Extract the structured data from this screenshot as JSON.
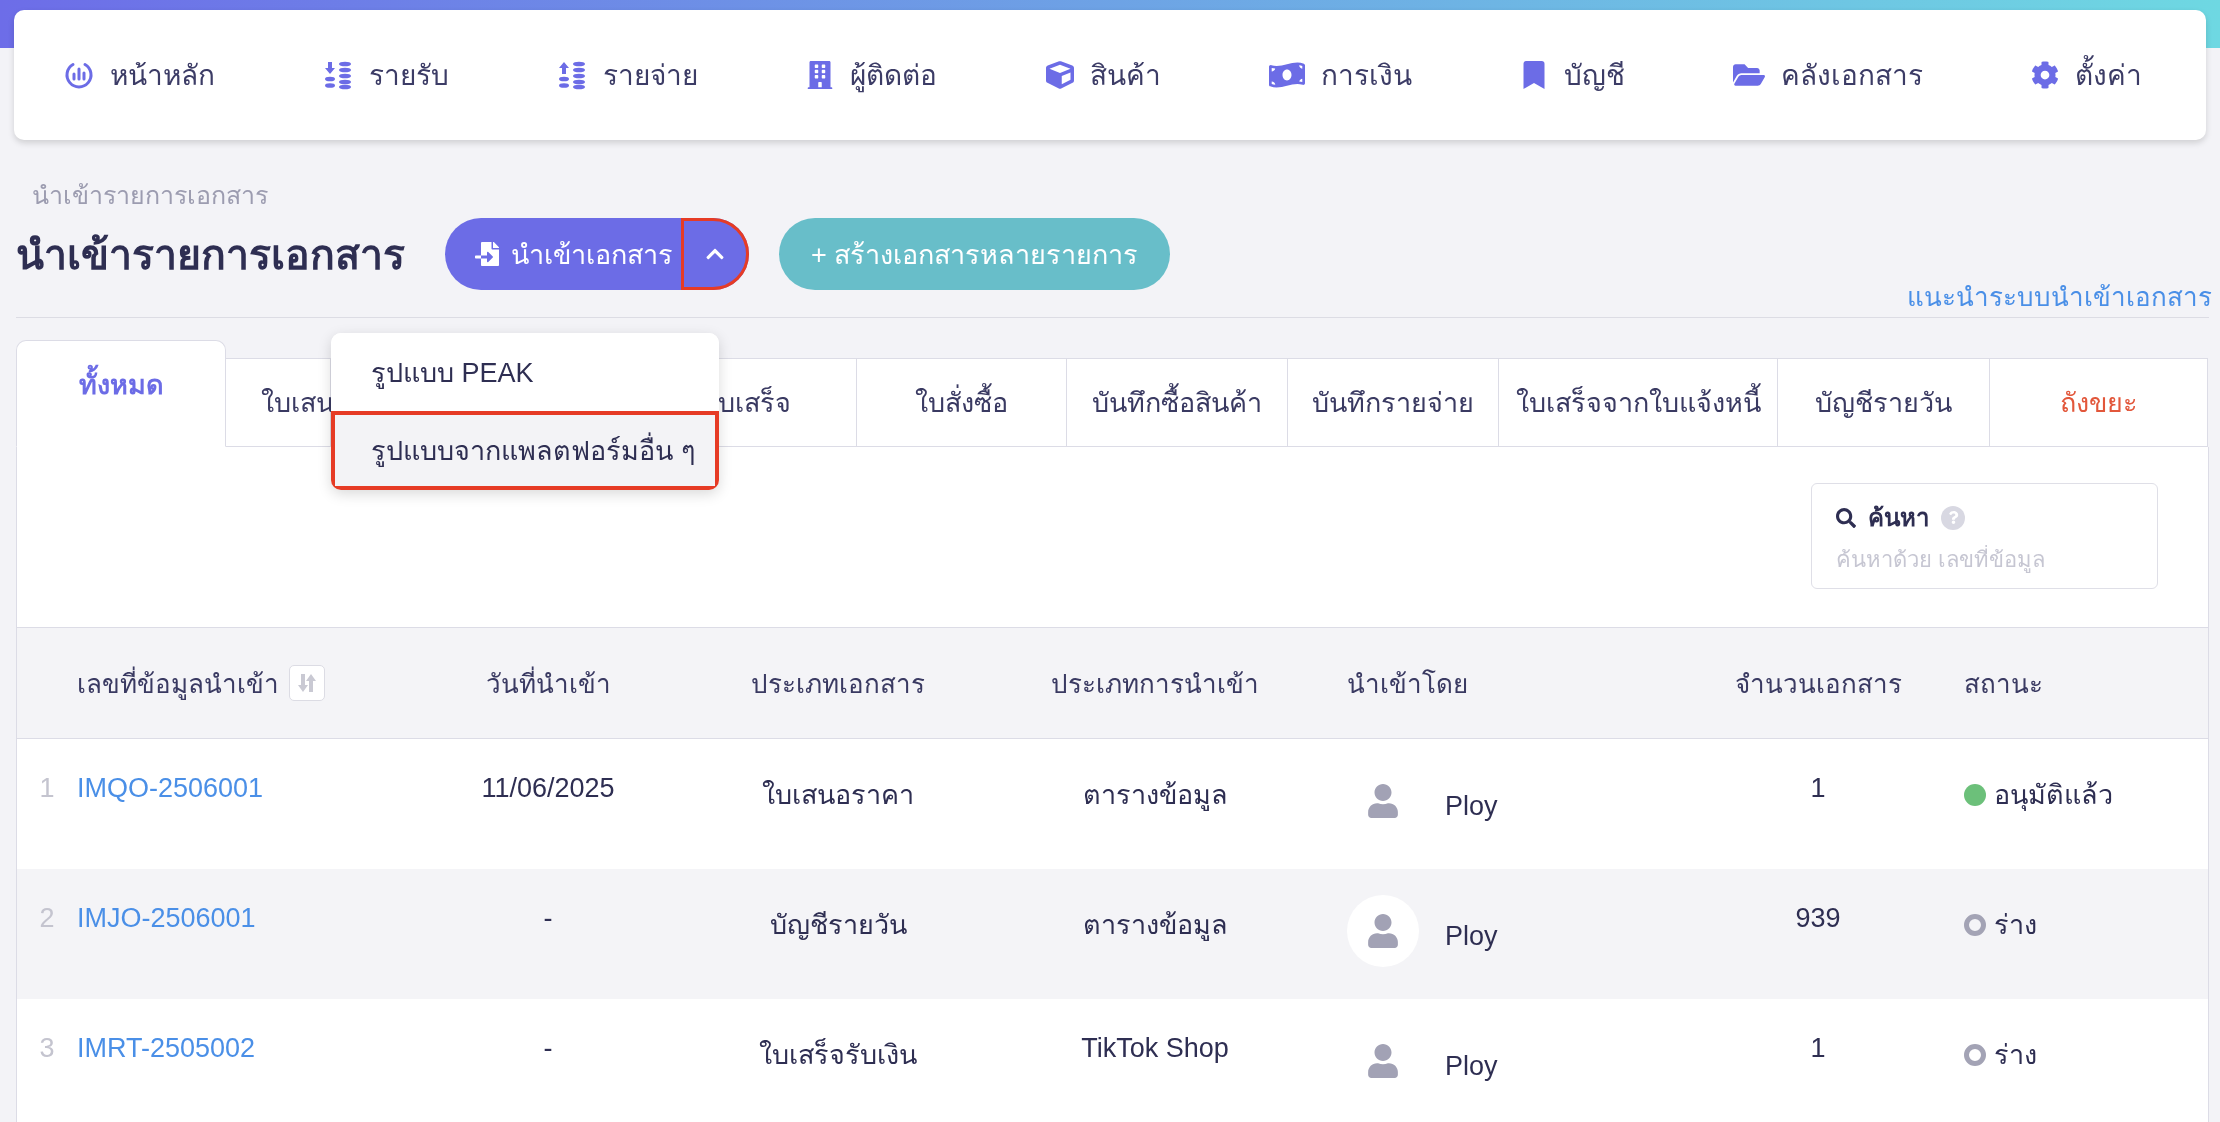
{
  "nav": [
    {
      "label": "หน้าหลัก"
    },
    {
      "label": "รายรับ"
    },
    {
      "label": "รายจ่าย"
    },
    {
      "label": "ผู้ติดต่อ"
    },
    {
      "label": "สินค้า"
    },
    {
      "label": "การเงิน"
    },
    {
      "label": "บัญชี"
    },
    {
      "label": "คลังเอกสาร"
    },
    {
      "label": "ตั้งค่า"
    }
  ],
  "breadcrumb": "นำเข้ารายการเอกสาร",
  "title": "นำเข้ารายการเอกสาร",
  "import_button": {
    "label": "นำเข้าเอกสาร",
    "expanded": true,
    "highlighted": true
  },
  "import_menu": [
    {
      "label": "รูปแบบ PEAK",
      "selected": false
    },
    {
      "label": "รูปแบบจากแพลตฟอร์มอื่น ๆ",
      "selected": true
    }
  ],
  "create_button": {
    "label": "+ สร้างเอกสารหลายรายการ"
  },
  "guide_link": "แนะนำระบบนำเข้าเอกสาร",
  "tabs": [
    {
      "label": "ทั้งหมด",
      "selected": true,
      "kind": "normal"
    },
    {
      "label": "ใบเสน",
      "selected": false,
      "kind": "normal"
    },
    {
      "label": "บเสร็จ",
      "selected": false,
      "kind": "normal"
    },
    {
      "label": "ใบสั่งซื้อ",
      "selected": false,
      "kind": "normal"
    },
    {
      "label": "บันทึกซื้อสินค้า",
      "selected": false,
      "kind": "normal"
    },
    {
      "label": "บันทึกรายจ่าย",
      "selected": false,
      "kind": "normal"
    },
    {
      "label": "ใบเสร็จจากใบแจ้งหนี้",
      "selected": false,
      "kind": "normal"
    },
    {
      "label": "บัญชีรายวัน",
      "selected": false,
      "kind": "normal"
    },
    {
      "label": "ถังขยะ",
      "selected": false,
      "kind": "danger"
    }
  ],
  "search": {
    "label": "ค้นหา",
    "placeholder": "ค้นหาด้วย เลขที่ข้อมูล"
  },
  "table": {
    "columns": [
      "เลขที่ข้อมูลนำเข้า",
      "วันที่นำเข้า",
      "ประเภทเอกสาร",
      "ประเภทการนำเข้า",
      "นำเข้าโดย",
      "จำนวนเอกสาร",
      "สถานะ"
    ],
    "rows": [
      {
        "index": "1",
        "id": "IMQO-2506001",
        "date": "11/06/2025",
        "doc_type": "ใบเสนอราคา",
        "import_type": "ตารางข้อมูล",
        "by": "Ploy",
        "count": "1",
        "status": "อนุมัติแล้ว",
        "kind": "filled",
        "color": "#6cc07a"
      },
      {
        "index": "2",
        "id": "IMJO-2506001",
        "date": "-",
        "doc_type": "บัญชีรายวัน",
        "import_type": "ตารางข้อมูล",
        "by": "Ploy",
        "count": "939",
        "status": "ร่าง",
        "kind": "ring",
        "color": "#a3a3b5"
      },
      {
        "index": "3",
        "id": "IMRT-2505002",
        "date": "-",
        "doc_type": "ใบเสร็จรับเงิน",
        "import_type": "TikTok Shop",
        "by": "Ploy",
        "count": "1",
        "status": "ร่าง",
        "kind": "ring",
        "color": "#a3a3b5"
      }
    ]
  }
}
